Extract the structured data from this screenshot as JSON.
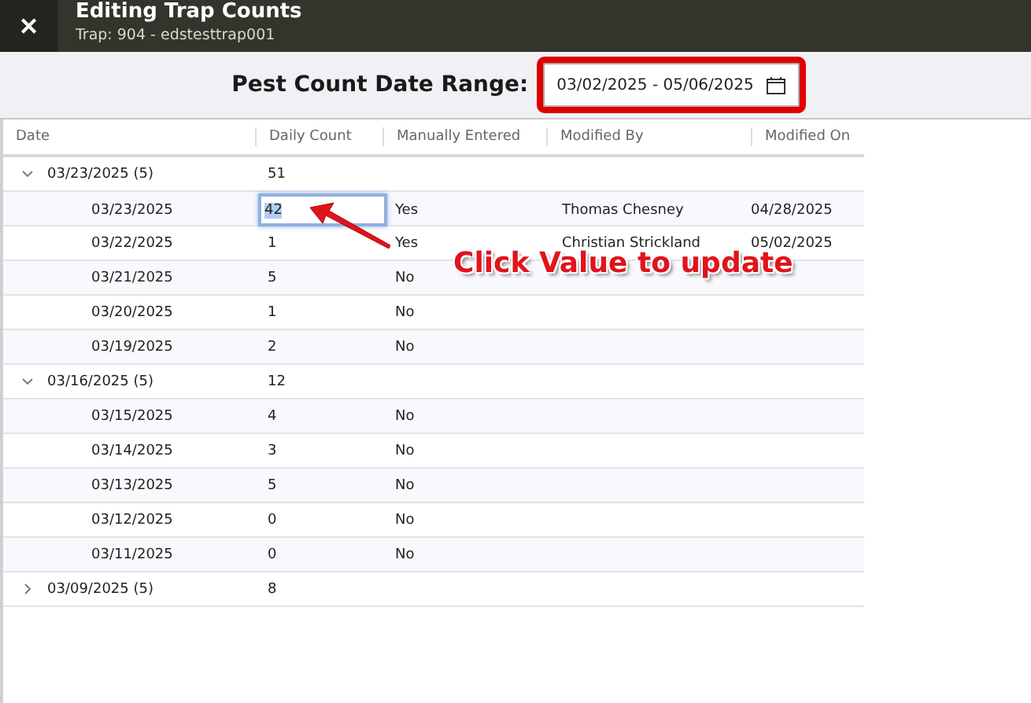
{
  "header": {
    "title": "Editing Trap Counts",
    "subtitle": "Trap: 904 - edstesttrap001",
    "close": "✕"
  },
  "filter": {
    "label": "Pest Count Date Range:",
    "value": "03/02/2025 - 05/06/2025"
  },
  "table": {
    "columns": [
      "Date",
      "Daily Count",
      "Manually Entered",
      "Modified By",
      "Modified On"
    ],
    "groups": [
      {
        "label": "03/23/2025 (5)",
        "total": "51",
        "expanded": true,
        "children": [
          {
            "date": "03/23/2025",
            "count": "42",
            "manual": "Yes",
            "modified_by": "Thomas Chesney",
            "modified_on": "04/28/2025",
            "editing": true
          },
          {
            "date": "03/22/2025",
            "count": "1",
            "manual": "Yes",
            "modified_by": "Christian Strickland",
            "modified_on": "05/02/2025",
            "editing": false
          },
          {
            "date": "03/21/2025",
            "count": "5",
            "manual": "No",
            "editing": false
          },
          {
            "date": "03/20/2025",
            "count": "1",
            "manual": "No",
            "editing": false
          },
          {
            "date": "03/19/2025",
            "count": "2",
            "manual": "No",
            "editing": false
          }
        ]
      },
      {
        "label": "03/16/2025 (5)",
        "total": "12",
        "expanded": true,
        "children": [
          {
            "date": "03/15/2025",
            "count": "4",
            "manual": "No",
            "editing": false
          },
          {
            "date": "03/14/2025",
            "count": "3",
            "manual": "No",
            "editing": false
          },
          {
            "date": "03/13/2025",
            "count": "5",
            "manual": "No",
            "editing": false
          },
          {
            "date": "03/12/2025",
            "count": "0",
            "manual": "No",
            "editing": false
          },
          {
            "date": "03/11/2025",
            "count": "0",
            "manual": "No",
            "editing": false
          }
        ]
      },
      {
        "label": "03/09/2025 (5)",
        "total": "8",
        "expanded": false
      }
    ]
  },
  "annotation": {
    "text": "Click Value to update"
  }
}
